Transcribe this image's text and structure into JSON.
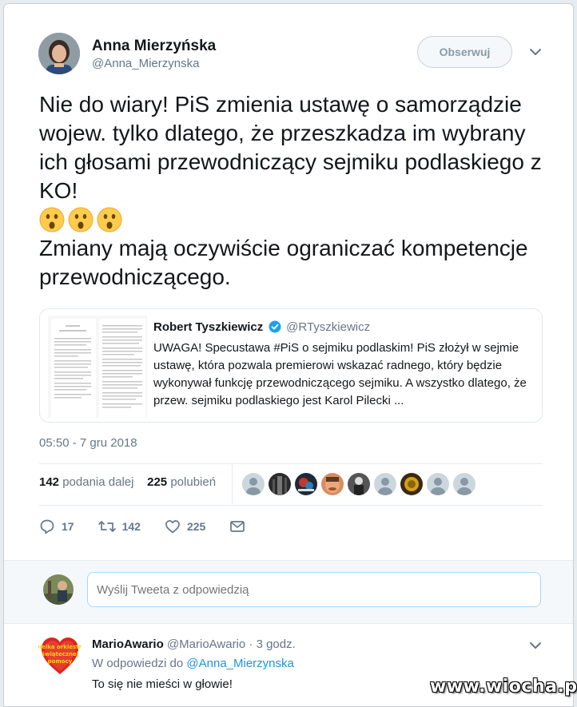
{
  "tweet": {
    "author_name": "Anna Mierzyńska",
    "author_handle": "@Anna_Mierzynska",
    "follow_label": "Obserwuj",
    "text_line1": "Nie do wiary! PiS zmienia ustawę o samorządzie wojew. tylko dlatego, że przeszkadza im wybrany ich głosami przewodniczący sejmiku podlaskiego z KO!",
    "emoji": "astonished-face-icon ×3",
    "text_line2": "Zmiany mają oczywiście ograniczać kompetencje przewodniczącego.",
    "timestamp": "05:50 - 7 gru 2018",
    "retweets_count": "142",
    "retweets_label": "podania dalej",
    "likes_count": "225",
    "likes_label": "polubień",
    "replies": "17",
    "retweets": "142",
    "likes": "225"
  },
  "quote": {
    "name": "Robert Tyszkiewicz",
    "handle": "@RTyszkiewicz",
    "text": "UWAGA! Specustawa #PiS o sejmiku podlaskim! PiS złożył w sejmie ustawę, która pozwala premierowi wskazać radnego, który będzie wykonywał funkcję przewodniczącego sejmiku. A wszystko dlatego, że przew. sejmiku podlaskiego jest Karol Pilecki ..."
  },
  "reply_box": {
    "placeholder": "Wyślij Tweeta z odpowiedzią"
  },
  "reply": {
    "name": "MarioAwario",
    "handle": "@MarioAwario",
    "time": "· 3 godz.",
    "reply_to_prefix": "W odpowiedzi do",
    "reply_to_handle": "@Anna_Mierzynska",
    "text": "To się nie mieści w głowie!",
    "avatar_text": "wielka orkiestra świątecznej pomocy"
  },
  "watermark": "www.wiocha.pl",
  "colors": {
    "accent": "#1da1f2",
    "link": "#1b95e0",
    "muted": "#657786",
    "heart_red": "#e0241b"
  }
}
